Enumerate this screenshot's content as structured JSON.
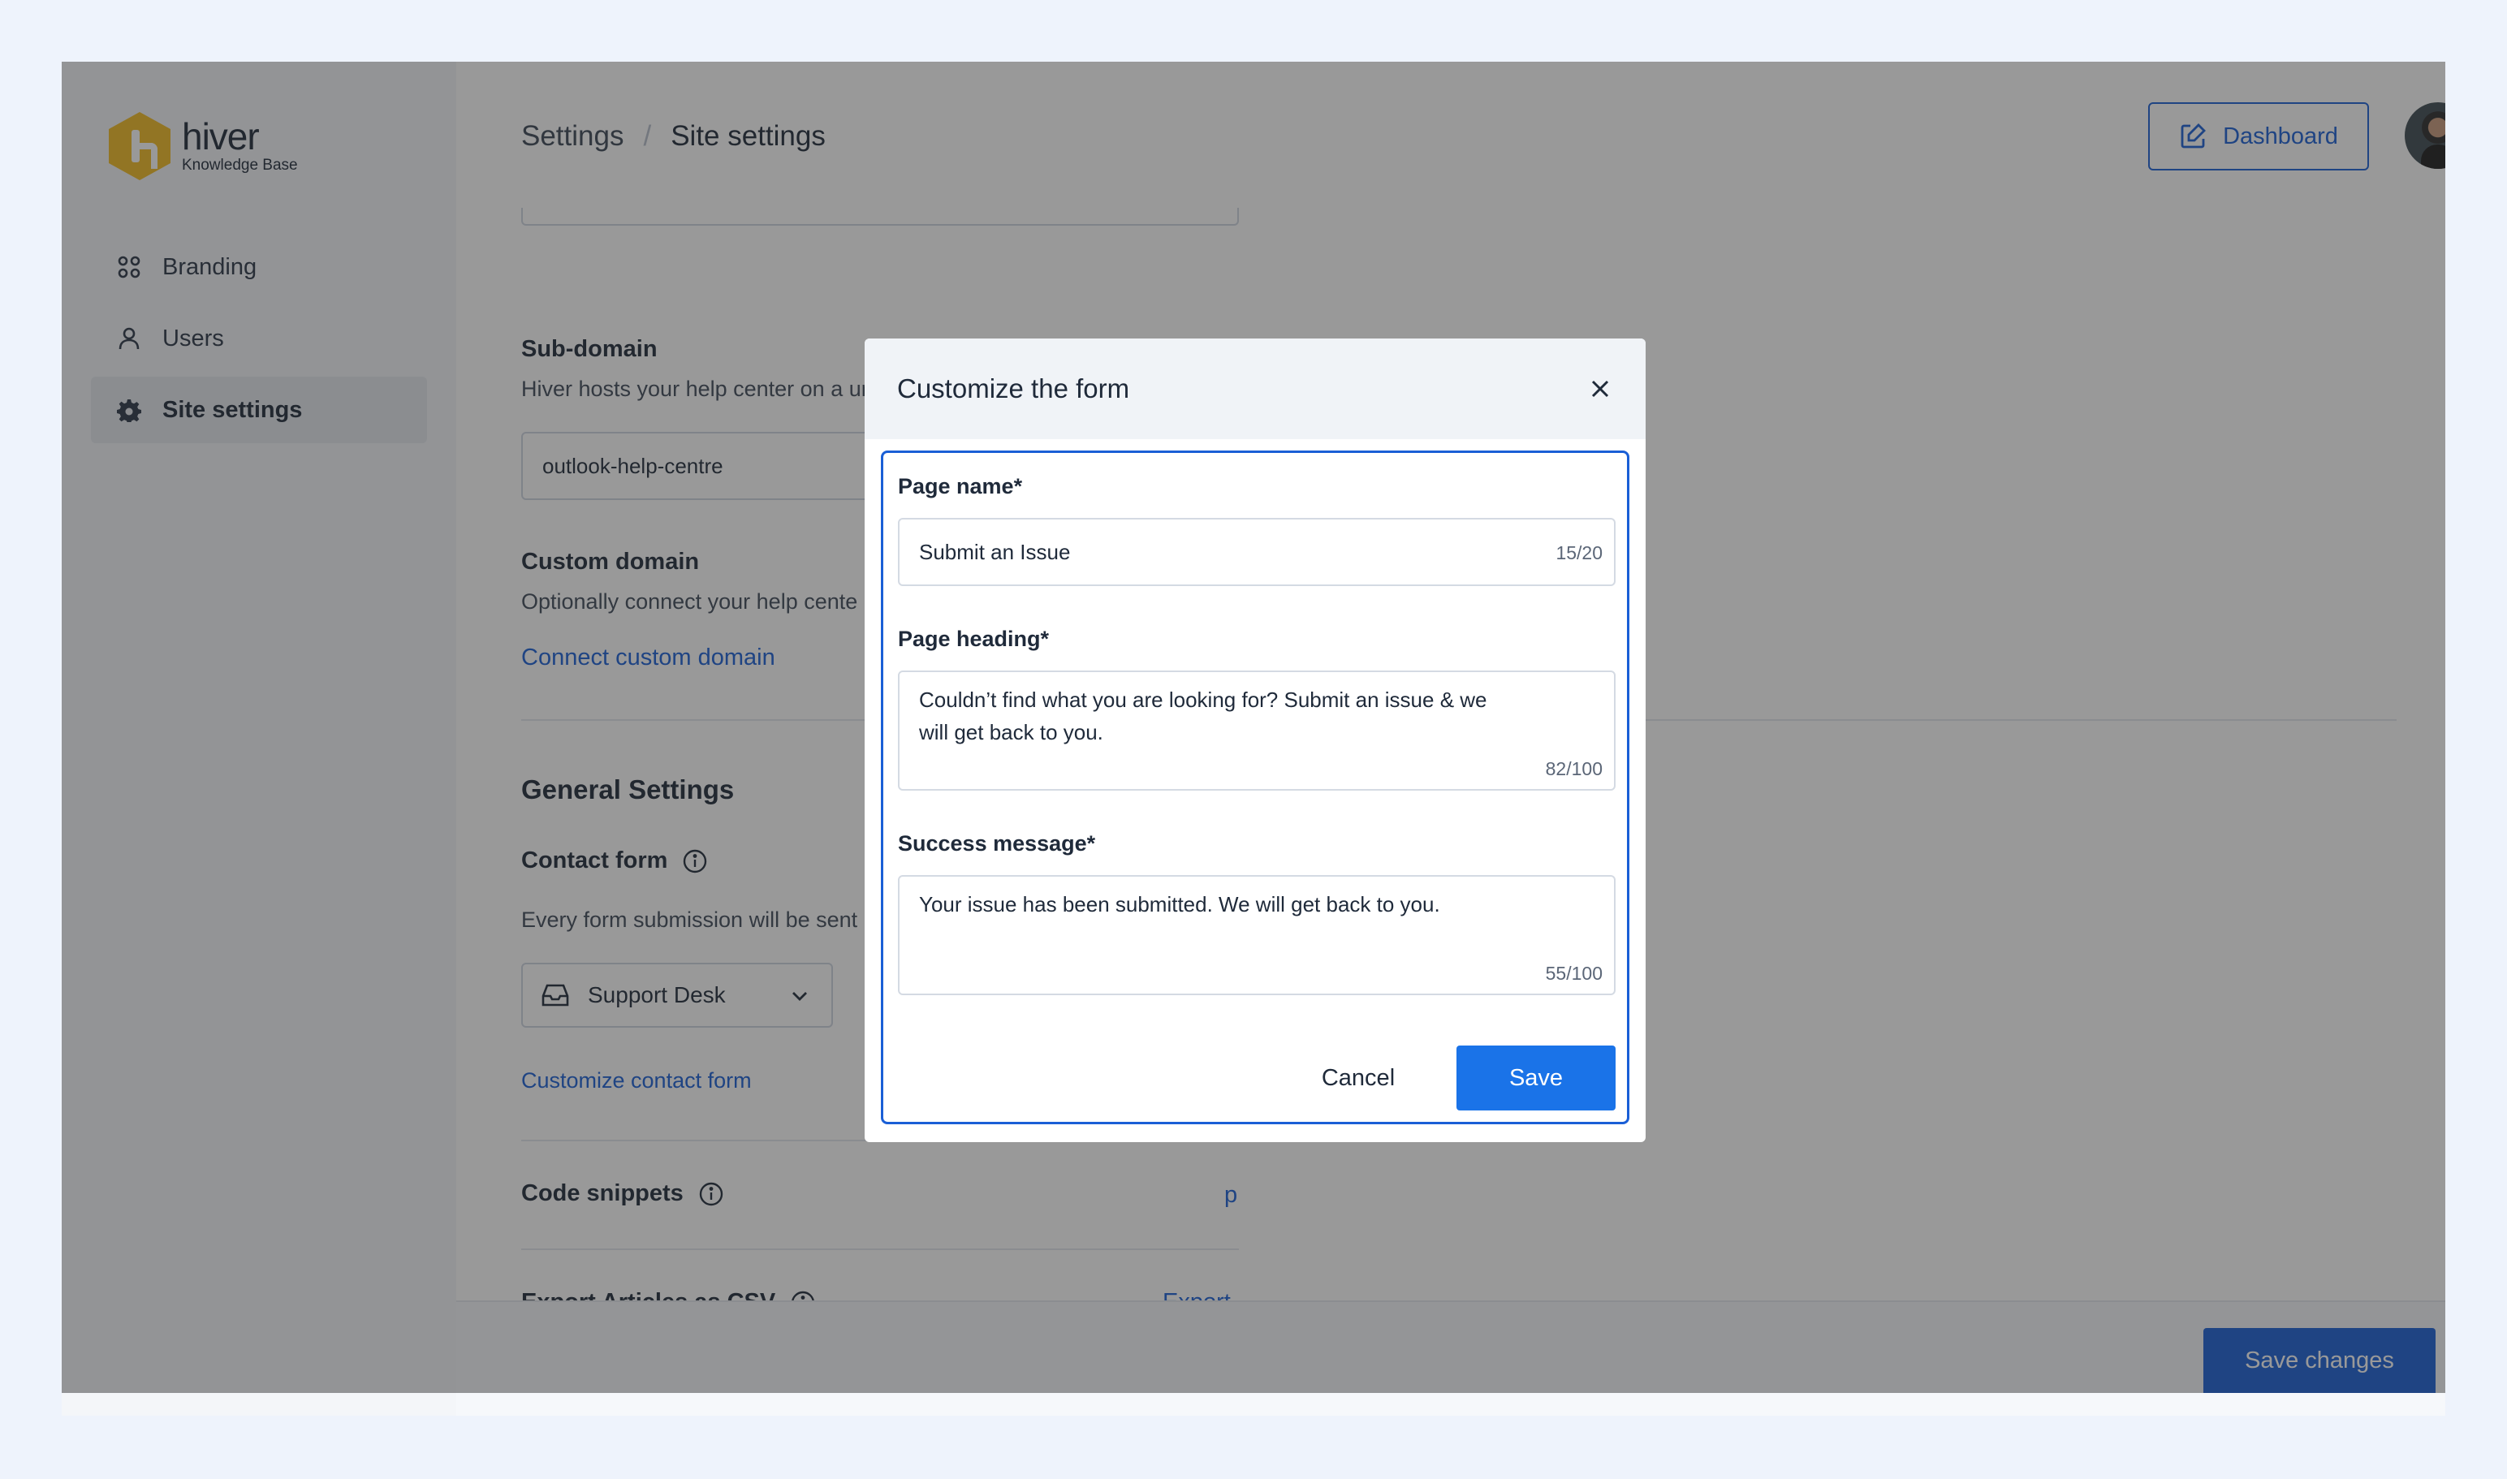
{
  "brand": {
    "name": "hiver",
    "subtitle": "Knowledge Base"
  },
  "sidebar": {
    "items": [
      {
        "label": "Branding",
        "icon": "grid-icon",
        "active": false
      },
      {
        "label": "Users",
        "icon": "user-icon",
        "active": false
      },
      {
        "label": "Site settings",
        "icon": "gear-icon",
        "active": true
      }
    ]
  },
  "header": {
    "breadcrumb_root": "Settings",
    "breadcrumb_separator": "/",
    "breadcrumb_current": "Site settings",
    "dashboard_label": "Dashboard"
  },
  "subdomain": {
    "title": "Sub-domain",
    "description": "Hiver hosts your help center on a unique subdomain of hiverkb.com",
    "value": "outlook-help-centre"
  },
  "custom_domain": {
    "title": "Custom domain",
    "description": "Optionally connect your help cente",
    "link": "Connect custom domain"
  },
  "general": {
    "title": "General Settings",
    "contact_form_label": "Contact form",
    "contact_form_desc": "Every form submission will be sent",
    "select_value": "Support Desk",
    "customize_link": "Customize contact form",
    "code_snippets_label": "Code snippets",
    "code_snippets_action_fragment": "p",
    "export_label": "Export Articles as CSV",
    "export_action": "Export"
  },
  "footer": {
    "save_changes": "Save changes"
  },
  "modal": {
    "title": "Customize the form",
    "page_name": {
      "label": "Page name*",
      "value": "Submit an Issue",
      "counter": "15/20"
    },
    "page_heading": {
      "label": "Page heading*",
      "value_line1": "Couldn’t find what you are looking for? Submit an issue & we",
      "value_line2": "will get back to you.",
      "counter": "82/100"
    },
    "success_message": {
      "label": "Success message*",
      "value": "Your issue has been submitted. We will get back to you.",
      "counter": "55/100"
    },
    "cancel_label": "Cancel",
    "save_label": "Save"
  },
  "colors": {
    "accent": "#1a5fd6",
    "primary_button": "#1a73e8",
    "logo": "#f2bb22",
    "page_background": "#eef3fc"
  }
}
